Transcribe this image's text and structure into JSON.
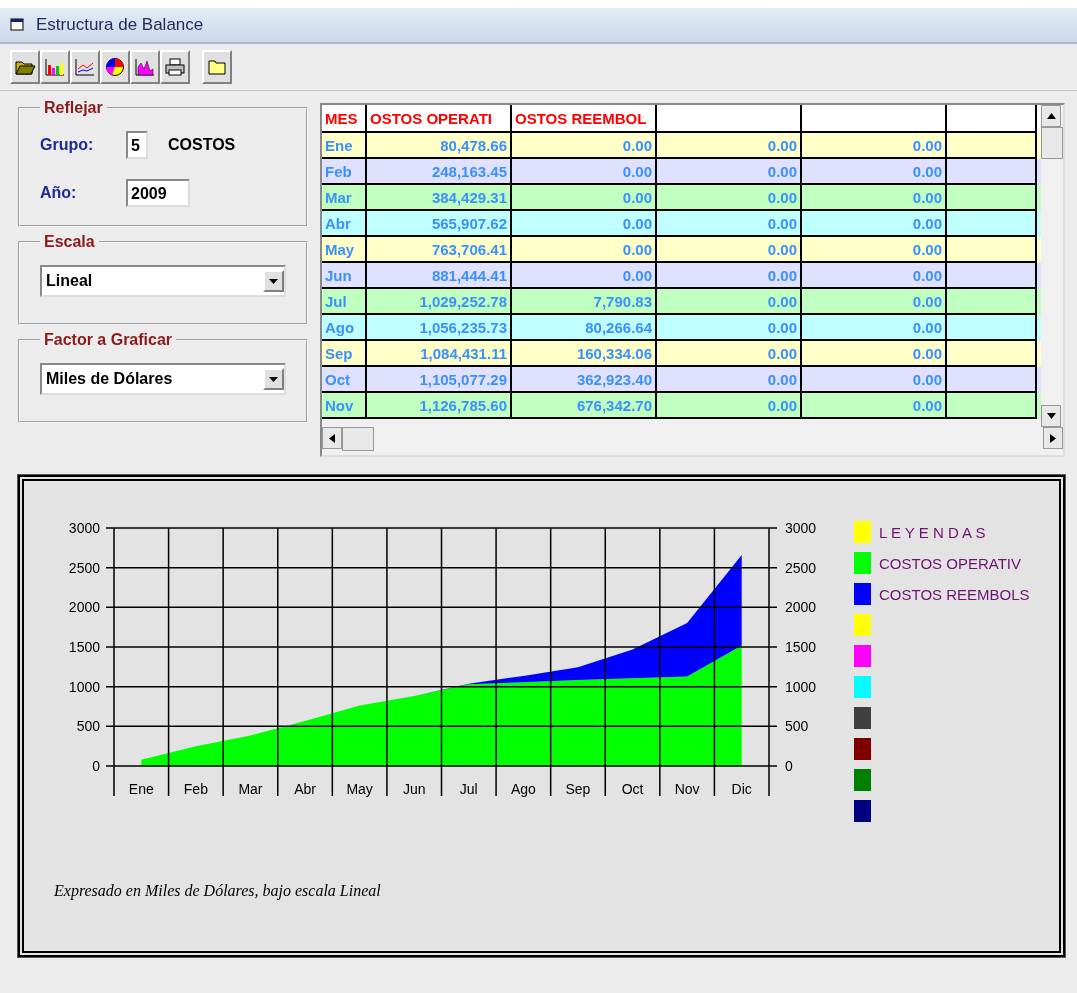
{
  "window": {
    "title": "Estructura de Balance"
  },
  "toolbar": {
    "buttons": [
      {
        "kind": "open"
      },
      {
        "kind": "bar"
      },
      {
        "kind": "line"
      },
      {
        "kind": "pie"
      },
      {
        "kind": "histogram"
      },
      {
        "kind": "print"
      },
      {
        "kind": "folder"
      }
    ]
  },
  "reflejar": {
    "title": "Reflejar",
    "grupo_label": "Grupo:",
    "grupo_value": "5",
    "grupo_name": "COSTOS",
    "anio_label": "Año:",
    "anio_value": "2009"
  },
  "escala": {
    "title": "Escala",
    "value": "Lineal"
  },
  "factor": {
    "title": "Factor a Graficar",
    "value": "Miles de Dólares"
  },
  "table": {
    "columns": [
      "MES",
      "OSTOS OPERATI",
      "OSTOS REEMBOL"
    ],
    "rows": [
      {
        "cells": [
          "Ene",
          "80,478.66",
          "0.00",
          "0.00",
          "0.00"
        ],
        "color": "#ffffc8"
      },
      {
        "cells": [
          "Feb",
          "248,163.45",
          "0.00",
          "0.00",
          "0.00"
        ],
        "color": "#e0e0ff"
      },
      {
        "cells": [
          "Mar",
          "384,429.31",
          "0.00",
          "0.00",
          "0.00"
        ],
        "color": "#c0ffc0"
      },
      {
        "cells": [
          "Abr",
          "565,907.62",
          "0.00",
          "0.00",
          "0.00"
        ],
        "color": "#c0ffff"
      },
      {
        "cells": [
          "May",
          "763,706.41",
          "0.00",
          "0.00",
          "0.00"
        ],
        "color": "#ffffc8"
      },
      {
        "cells": [
          "Jun",
          "881,444.41",
          "0.00",
          "0.00",
          "0.00"
        ],
        "color": "#e0e0ff"
      },
      {
        "cells": [
          "Jul",
          "1,029,252.78",
          "7,790.83",
          "0.00",
          "0.00"
        ],
        "color": "#c0ffc0"
      },
      {
        "cells": [
          "Ago",
          "1,056,235.73",
          "80,266.64",
          "0.00",
          "0.00"
        ],
        "color": "#c0ffff"
      },
      {
        "cells": [
          "Sep",
          "1,084,431.11",
          "160,334.06",
          "0.00",
          "0.00"
        ],
        "color": "#ffffc8"
      },
      {
        "cells": [
          "Oct",
          "1,105,077.29",
          "362,923.40",
          "0.00",
          "0.00"
        ],
        "color": "#e0e0ff"
      },
      {
        "cells": [
          "Nov",
          "1,126,785.60",
          "676,342.70",
          "0.00",
          "0.00"
        ],
        "color": "#c0ffc0"
      }
    ]
  },
  "chart": {
    "chart_data": {
      "type": "area",
      "stacked": true,
      "categories": [
        "Ene",
        "Feb",
        "Mar",
        "Abr",
        "May",
        "Jun",
        "Jul",
        "Ago",
        "Sep",
        "Oct",
        "Nov",
        "Dic"
      ],
      "series": [
        {
          "name": "COSTOS OPERATIV",
          "color": "#00ff00",
          "values": [
            80,
            248,
            384,
            566,
            764,
            881,
            1029,
            1056,
            1084,
            1105,
            1127,
            1520
          ]
        },
        {
          "name": "COSTOS REEMBOLS",
          "color": "#0000ff",
          "values": [
            0,
            0,
            0,
            0,
            0,
            0,
            8,
            80,
            160,
            363,
            676,
            1140
          ]
        }
      ],
      "ylim": [
        0,
        3000
      ],
      "yticks": [
        0,
        500,
        1000,
        1500,
        2000,
        2500,
        3000
      ],
      "y2ticks": [
        0,
        500,
        1000,
        1500,
        2000,
        2500,
        3000
      ],
      "y2lim": [
        0,
        3000
      ],
      "grid": true
    },
    "legend_title": {
      "label": "L E Y E N D A S",
      "color": "#ffff00"
    },
    "legend": [
      {
        "color": "#ffff00"
      },
      {
        "color": "#ff00ff"
      },
      {
        "color": "#00ffff"
      },
      {
        "color": "#404040"
      },
      {
        "color": "#800000"
      },
      {
        "color": "#008000"
      },
      {
        "color": "#000080"
      }
    ],
    "footnote": "Expresado en Miles de Dólares, bajo escala Lineal"
  }
}
